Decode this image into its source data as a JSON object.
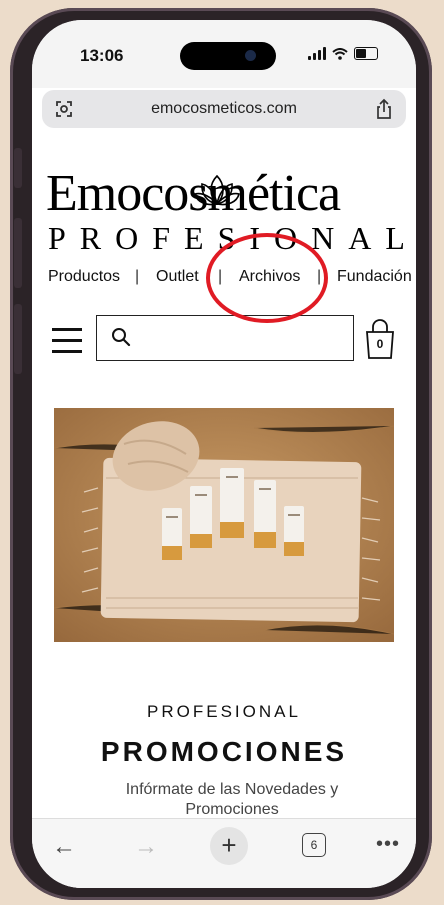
{
  "status_bar": {
    "time": "13:06"
  },
  "browser": {
    "url": "emocosmeticos.com",
    "toolbar": {
      "tab_count": "6",
      "plus_label": "+",
      "back_label": "←",
      "forward_label": "→",
      "more_label": "•••"
    }
  },
  "header": {
    "logo_main": "Emocosmética",
    "logo_sub": "PROFESIONAL",
    "nav_items": [
      {
        "label": "Productos"
      },
      {
        "label": "Outlet"
      },
      {
        "label": "Archivos"
      },
      {
        "label": "Fundación"
      }
    ],
    "nav_separator": "|",
    "cart_count": "0"
  },
  "content": {
    "section_kicker": "PROFESIONAL",
    "section_title": "PROMOCIONES",
    "section_desc": "Infórmate de las Novedades y Promociones"
  },
  "fab": {
    "label": "•••"
  },
  "colors": {
    "annotation": "#e01b24",
    "text": "#111111",
    "banner_sand": "#b98955"
  }
}
